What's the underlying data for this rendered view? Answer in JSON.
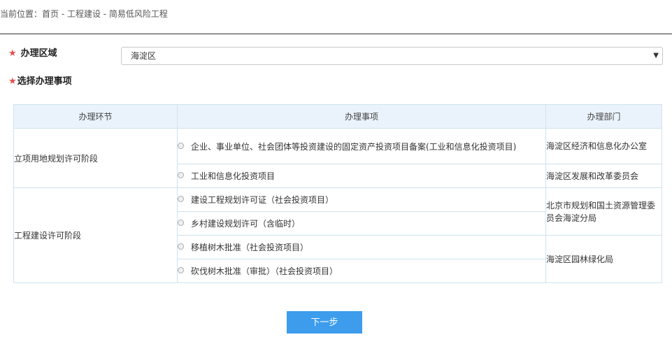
{
  "breadcrumb": {
    "text": "当前位置：首页 - 工程建设 - 简易低风险工程"
  },
  "form": {
    "region_label": "办理区域",
    "region_value": "海淀区",
    "items_label": "选择办理事项",
    "required_mark": "★"
  },
  "table": {
    "headers": [
      "办理环节",
      "办理事项",
      "办理部门"
    ],
    "stages": [
      "立项用地规划许可阶段",
      "工程建设许可阶段"
    ],
    "items": [
      "企业、事业单位、社会团体等投资建设的固定资产投资项目备案(工业和信息化投资项目)",
      "工业和信息化投资项目",
      "建设工程规划许可证（社会投资项目）",
      "乡村建设规划许可（含临时）",
      "移植树木批准（社会投资项目）",
      "砍伐树木批准（审批）（社会投资项目）"
    ],
    "departments": [
      "海淀区经济和信息化办公室",
      "海淀区发展和改革委员会",
      "北京市规划和国土资源管理委员会海淀分局",
      "海淀区园林绿化局"
    ]
  },
  "actions": {
    "next_label": "下一步"
  },
  "colors": {
    "accent": "#3d9cec",
    "required": "#e84c4c",
    "header_bg": "#eaf3fb",
    "border": "#cfe2ee"
  }
}
